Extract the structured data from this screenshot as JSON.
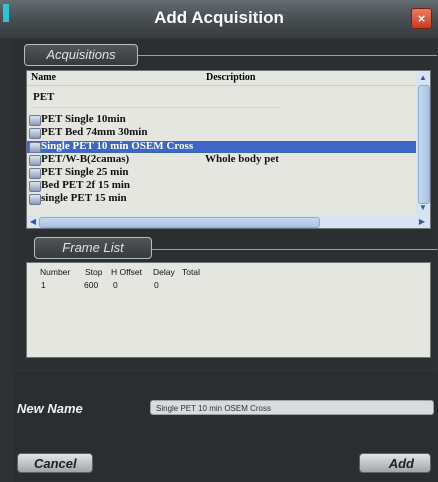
{
  "window": {
    "title": "Add Acquisition",
    "close_glyph": "×"
  },
  "acquisitions": {
    "label": "Acquisitions",
    "columns": [
      "Name",
      "Description"
    ],
    "group": "PET",
    "rows": [
      {
        "name": "PET Single 10min",
        "desc": ""
      },
      {
        "name": "PET Bed 74mm 30min",
        "desc": ""
      },
      {
        "name": "Single PET 10 min OSEM Cross",
        "desc": "",
        "selected": true
      },
      {
        "name": "PET/W-B(2camas)",
        "desc": "Whole body pet"
      },
      {
        "name": "PET Single 25 min",
        "desc": ""
      },
      {
        "name": "Bed PET 2f 15 min",
        "desc": ""
      },
      {
        "name": "single PET 15 min",
        "desc": ""
      }
    ]
  },
  "frame_list": {
    "label": "Frame List",
    "columns": [
      "Number",
      "Stop",
      "H Offset",
      "Delay",
      "Total"
    ],
    "rows": [
      [
        "1",
        "600",
        "0",
        "0",
        ""
      ]
    ]
  },
  "new_name": {
    "label": "New Name",
    "value": "Single PET 10 min OSEM Cross"
  },
  "buttons": {
    "cancel": "Cancel",
    "add": "Add"
  },
  "colors": {
    "accent": "#2fc3d4",
    "selection": "#3d67c7",
    "close": "#d5452b"
  },
  "icons": {
    "close": "close-icon",
    "row": "acquisition-icon"
  }
}
